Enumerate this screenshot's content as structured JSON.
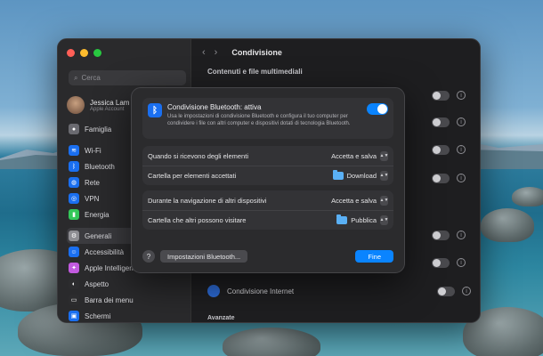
{
  "sidebar": {
    "search_placeholder": "Cerca",
    "profile_name": "Jessica Lam",
    "profile_sub": "Apple Account",
    "items": [
      {
        "label": "Famiglia",
        "color": "#6a6a70"
      },
      {
        "label": "Wi-Fi",
        "color": "#1a6ff0"
      },
      {
        "label": "Bluetooth",
        "color": "#1a6ff0"
      },
      {
        "label": "Rete",
        "color": "#1a6ff0"
      },
      {
        "label": "VPN",
        "color": "#1a6ff0"
      },
      {
        "label": "Energia",
        "color": "#34c759"
      },
      {
        "label": "Generali",
        "color": "#8e8e93"
      },
      {
        "label": "Accessibilità",
        "color": "#1a6ff0"
      },
      {
        "label": "Apple Intelligence",
        "color": "#c25adf"
      },
      {
        "label": "Aspetto",
        "color": "#2c2c2e"
      },
      {
        "label": "Barra dei menu",
        "color": "#2c2c2e"
      },
      {
        "label": "Schermi",
        "color": "#1a6ff0"
      }
    ]
  },
  "content": {
    "title": "Condivisione",
    "section1": "Contenuti e file multimediali",
    "internet_sharing": "Condivisione Internet",
    "section2": "Avanzate"
  },
  "dialog": {
    "title": "Condivisione Bluetooth: attiva",
    "description": "Usa le impostazioni di condivisione Bluetooth e configura il tuo computer per condividere i file con altri computer e dispositivi dotati di tecnologia Bluetooth.",
    "toggle_on": true,
    "rows1": [
      {
        "label": "Quando si ricevono degli elementi",
        "value": "Accetta e salva",
        "folder": false
      },
      {
        "label": "Cartella per elementi accettati",
        "value": "Download",
        "folder": true
      }
    ],
    "rows2": [
      {
        "label": "Durante la navigazione di altri dispositivi",
        "value": "Accetta e salva",
        "folder": false
      },
      {
        "label": "Cartella che altri possono visitare",
        "value": "Pubblica",
        "folder": true
      }
    ],
    "help_label": "?",
    "settings_button": "Impostazioni Bluetooth...",
    "done_button": "Fine"
  },
  "colors": {
    "accent": "#0a84ff",
    "window_bg": "#1e1e20"
  }
}
